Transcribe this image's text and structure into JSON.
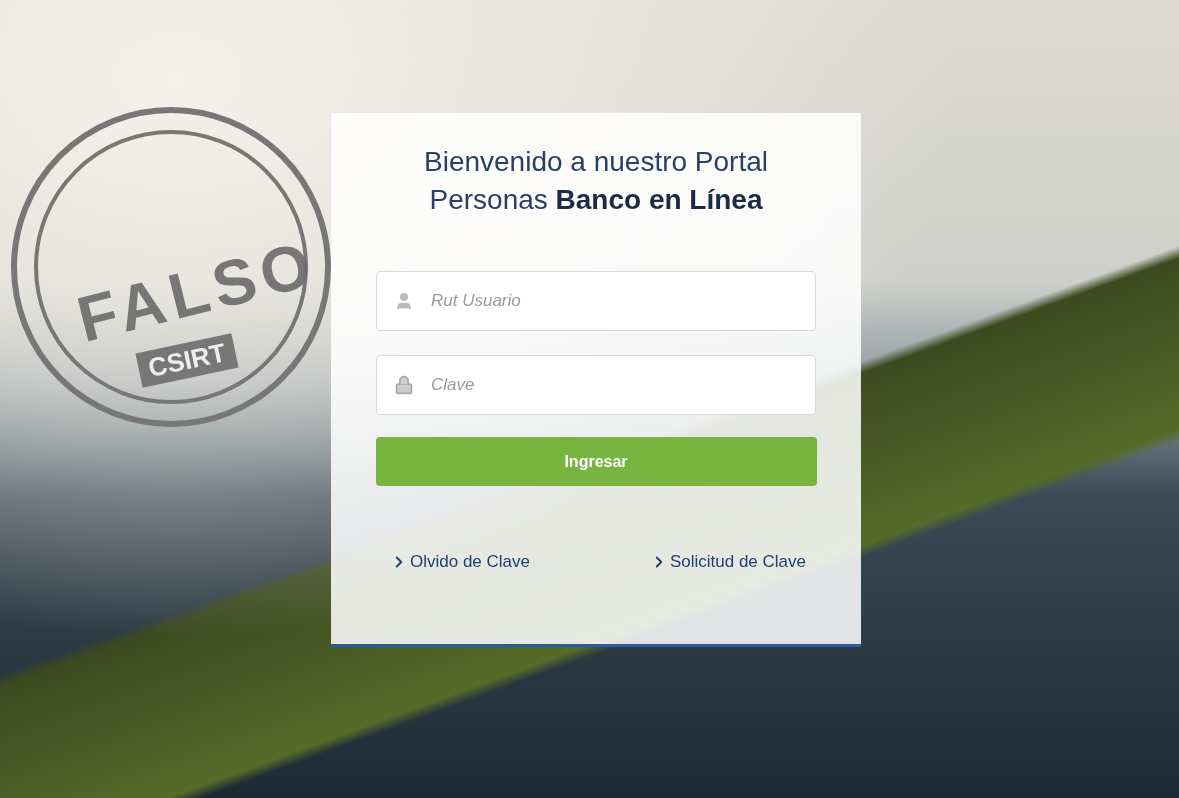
{
  "stamp": {
    "label": "FALSO",
    "sublabel": "CSIRT"
  },
  "login": {
    "title": "Bienvenido a nuestro Portal Personas **Banco en Línea**",
    "fields": [
      {
        "kind": "user",
        "placeholder": "Rut Usuario"
      },
      {
        "kind": "password",
        "placeholder": "Clave"
      }
    ],
    "submit": "Ingresar",
    "links": [
      "Olvido de Clave",
      "Solicitud de Clave"
    ]
  }
}
